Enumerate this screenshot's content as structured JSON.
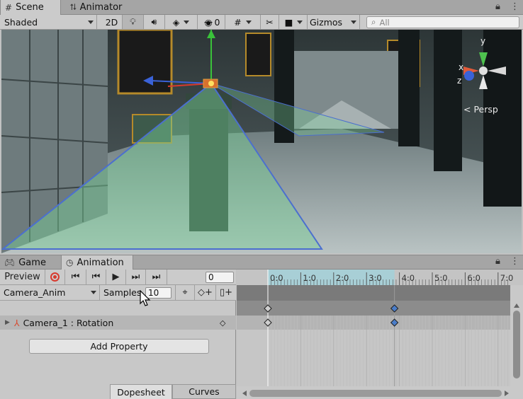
{
  "scene_tabs": [
    {
      "label": "Scene",
      "icon": "grid-icon",
      "active": true
    },
    {
      "label": "Animator",
      "icon": "animator-icon",
      "active": false
    }
  ],
  "scene_toolbar": {
    "shading_mode": "Shaded",
    "two_d_label": "2D",
    "hidden_count": "0",
    "gizmos_label": "Gizmos",
    "search_placeholder": "All"
  },
  "viewport": {
    "projection_label": "< Persp",
    "gizmo_axes": {
      "y": "y",
      "x": "x",
      "z": "z"
    }
  },
  "anim_tabs": [
    {
      "label": "Game",
      "icon": "gamepad-icon",
      "active": false
    },
    {
      "label": "Animation",
      "icon": "clock-icon",
      "active": true
    }
  ],
  "animation": {
    "preview_label": "Preview",
    "current_frame": "0",
    "clip_name": "Camera_Anim",
    "samples_label": "Samples",
    "samples_value": "10",
    "property_label": "Camera_1 : Rotation",
    "add_property_label": "Add Property",
    "bottom_tabs": {
      "dopesheet": "Dopesheet",
      "curves": "Curves"
    }
  },
  "timeline": {
    "ticks": [
      "0:0",
      "1:0",
      "2:0",
      "3:0",
      "4:0",
      "5:0",
      "6:0",
      "7:0"
    ],
    "clip_range": [
      0,
      3.85
    ],
    "playhead": 0,
    "keyframes": [
      0,
      3.85
    ],
    "selected_keyframe_color": "#4a7dc9",
    "range_highlight_color": "#a8cfd6"
  },
  "colors": {
    "record_red": "#d83a2e",
    "frustum_green": "#7ad29a",
    "frustum_edge_blue": "#4b6fcf"
  }
}
